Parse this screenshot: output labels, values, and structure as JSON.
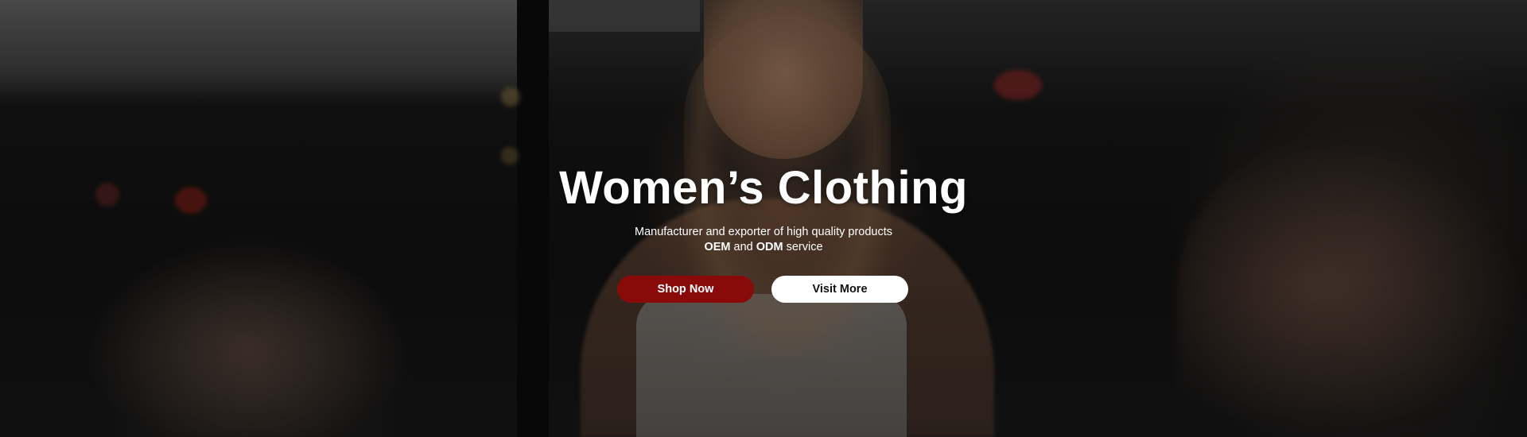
{
  "hero": {
    "title": "Women’s Clothing",
    "subtitle_line1": "Manufacturer and exporter of high quality products",
    "subtitle_line2": {
      "oem": "OEM",
      "and": "and",
      "odm": "ODM",
      "service": "service"
    },
    "buttons": {
      "shop_now": "Shop Now",
      "visit_more": "Visit More"
    },
    "colors": {
      "primary_button": "#8a0a0a",
      "secondary_button": "#ffffff",
      "text": "#ffffff"
    }
  }
}
